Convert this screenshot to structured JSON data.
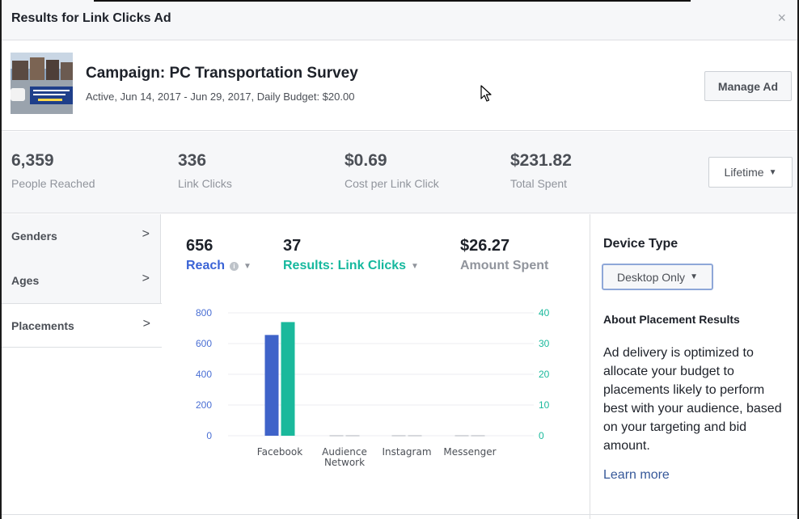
{
  "header": {
    "title": "Results for Link Clicks Ad",
    "close": "×"
  },
  "campaign": {
    "name": "Campaign: PC Transportation Survey",
    "subtitle": "Active, Jun 14, 2017 - Jun 29, 2017, Daily Budget: $20.00",
    "manage_label": "Manage Ad"
  },
  "stats": [
    {
      "value": "6,359",
      "label": "People Reached"
    },
    {
      "value": "336",
      "label": "Link Clicks"
    },
    {
      "value": "$0.69",
      "label": "Cost per Link Click"
    },
    {
      "value": "$231.82",
      "label": "Total Spent"
    }
  ],
  "period": {
    "label": "Lifetime"
  },
  "nav": {
    "items": [
      {
        "label": "Genders"
      },
      {
        "label": "Ages"
      },
      {
        "label": "Placements"
      }
    ],
    "active_index": 2
  },
  "metrics": [
    {
      "value": "656",
      "label": "Reach",
      "color": "#3b64d6"
    },
    {
      "value": "37",
      "label": "Results: Link Clicks",
      "color": "#16b89e"
    },
    {
      "value": "$26.27",
      "label": "Amount Spent",
      "color": "#90949c"
    }
  ],
  "chart_data": {
    "type": "bar",
    "categories": [
      "Facebook",
      "Audience Network",
      "Instagram",
      "Messenger"
    ],
    "series": [
      {
        "name": "Reach",
        "axis": "left",
        "color": "#3f63c9",
        "values": [
          656,
          0,
          0,
          0
        ]
      },
      {
        "name": "Results: Link Clicks",
        "axis": "right",
        "color": "#1ab99c",
        "values": [
          37,
          0,
          0,
          0
        ]
      }
    ],
    "y_left": {
      "ticks": [
        0,
        200,
        400,
        600,
        800
      ],
      "range": [
        0,
        800
      ]
    },
    "y_right": {
      "ticks": [
        0,
        10,
        20,
        30,
        40
      ],
      "range": [
        0,
        40
      ]
    },
    "grid": true,
    "tick_color_left": "#4a6fd4",
    "tick_color_right": "#1ab99c"
  },
  "device": {
    "title": "Device Type",
    "selected": "Desktop Only"
  },
  "about": {
    "title": "About Placement Results",
    "body": "Ad delivery is optimized to allocate your budget to placements likely to perform best with your audience, based on your targeting and bid amount.",
    "link": "Learn more"
  }
}
